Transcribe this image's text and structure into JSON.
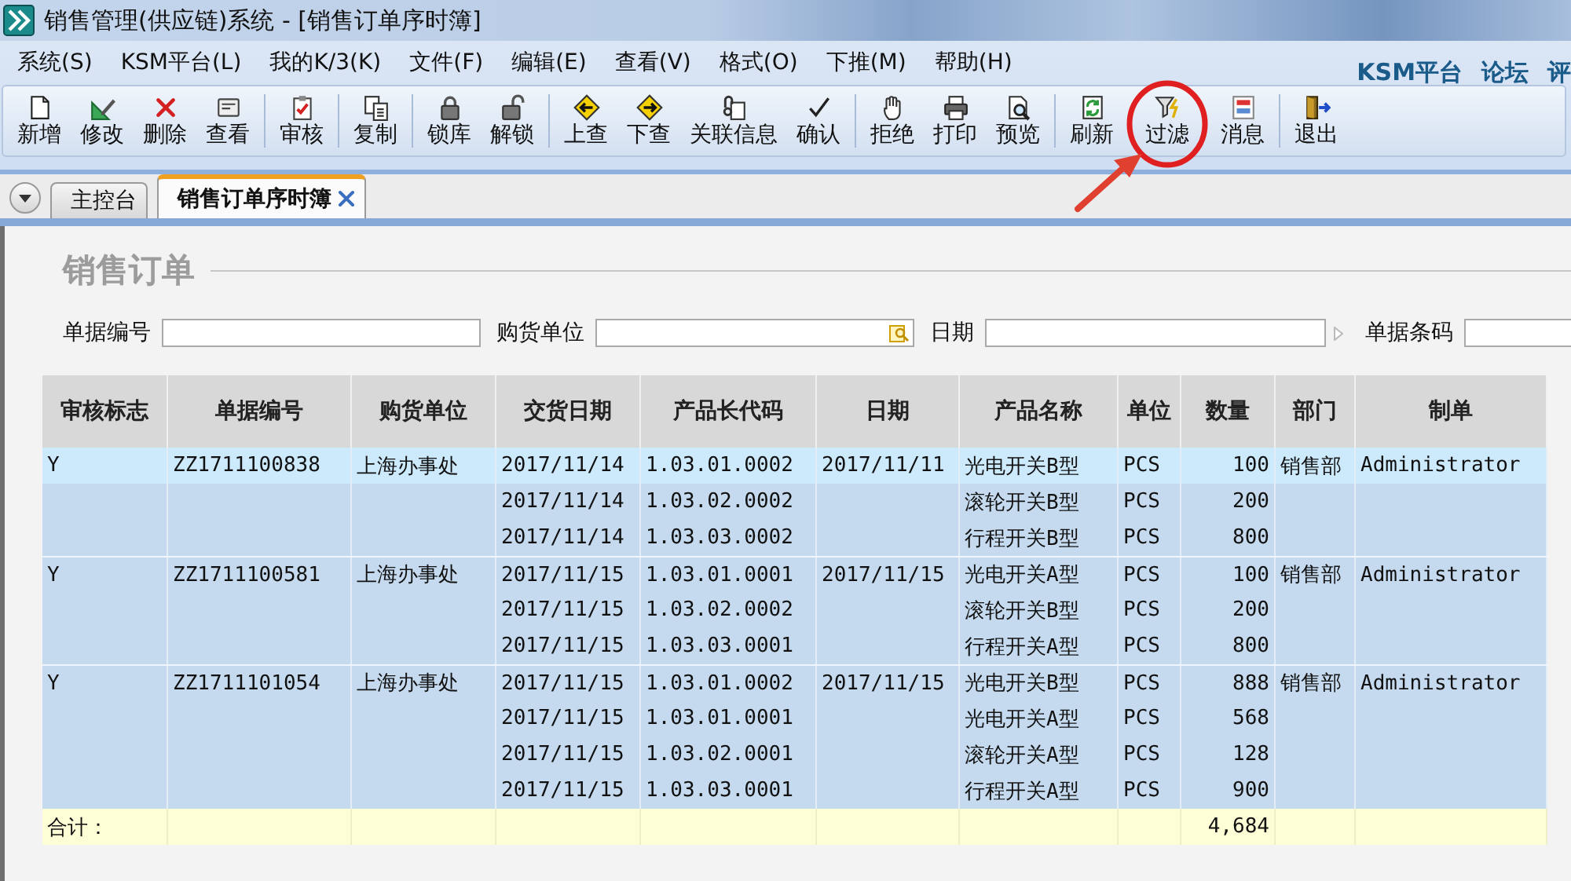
{
  "window": {
    "title": "销售管理(供应链)系统 - [销售订单序时簿]"
  },
  "menu": {
    "items": [
      "系统(S)",
      "KSM平台(L)",
      "我的K/3(K)",
      "文件(F)",
      "编辑(E)",
      "查看(V)",
      "格式(O)",
      "下推(M)",
      "帮助(H)"
    ],
    "links": [
      "KSM平台",
      "论坛",
      "评"
    ]
  },
  "toolbar": {
    "groups": [
      {
        "buttons": [
          {
            "label": "新增",
            "highlighted": false
          },
          {
            "label": "修改",
            "highlighted": false
          },
          {
            "label": "删除",
            "highlighted": false
          },
          {
            "label": "查看",
            "highlighted": false
          }
        ]
      },
      {
        "buttons": [
          {
            "label": "审核",
            "highlighted": false
          }
        ]
      },
      {
        "buttons": [
          {
            "label": "复制",
            "highlighted": false
          }
        ]
      },
      {
        "buttons": [
          {
            "label": "锁库",
            "highlighted": false
          },
          {
            "label": "解锁",
            "highlighted": false
          }
        ]
      },
      {
        "buttons": [
          {
            "label": "上查",
            "highlighted": false
          },
          {
            "label": "下查",
            "highlighted": false
          },
          {
            "label": "关联信息",
            "highlighted": false
          },
          {
            "label": "确认",
            "highlighted": false
          }
        ]
      },
      {
        "buttons": [
          {
            "label": "拒绝",
            "highlighted": false
          },
          {
            "label": "打印",
            "highlighted": false
          },
          {
            "label": "预览",
            "highlighted": false
          }
        ]
      },
      {
        "buttons": [
          {
            "label": "刷新",
            "highlighted": false
          },
          {
            "label": "过滤",
            "highlighted": true
          },
          {
            "label": "消息",
            "highlighted": false
          }
        ]
      },
      {
        "buttons": [
          {
            "label": "退出",
            "highlighted": false
          }
        ]
      }
    ]
  },
  "tabs": [
    {
      "label": "主控台",
      "selected": false
    },
    {
      "label": "销售订单序时簿",
      "selected": true
    }
  ],
  "form": {
    "title": "销售订单",
    "fields": [
      {
        "label": "单据编号",
        "kind": "text"
      },
      {
        "label": "购货单位",
        "kind": "lookup"
      },
      {
        "label": "日期",
        "kind": "range"
      },
      {
        "label": "单据条码",
        "kind": "text"
      }
    ]
  },
  "table": {
    "columns": [
      "审核标志",
      "单据编号",
      "购货单位",
      "交货日期",
      "产品长代码",
      "日期",
      "产品名称",
      "单位",
      "数量",
      "部门",
      "制单"
    ],
    "orders": [
      {
        "audit": "Y",
        "number": "ZZ1711100838",
        "customer": "上海办事处",
        "date": "2017/11/11",
        "department": "销售部",
        "maker": "Administrator",
        "lines": [
          {
            "delivery_date": "2017/11/14",
            "code": "1.03.01.0002",
            "product": "光电开关B型",
            "unit": "PCS",
            "quantity": "100",
            "selected": true
          },
          {
            "delivery_date": "2017/11/14",
            "code": "1.03.02.0002",
            "product": "滚轮开关B型",
            "unit": "PCS",
            "quantity": "200",
            "selected": false
          },
          {
            "delivery_date": "2017/11/14",
            "code": "1.03.03.0002",
            "product": "行程开关B型",
            "unit": "PCS",
            "quantity": "800",
            "selected": false
          }
        ]
      },
      {
        "audit": "Y",
        "number": "ZZ1711100581",
        "customer": "上海办事处",
        "date": "2017/11/15",
        "department": "销售部",
        "maker": "Administrator",
        "lines": [
          {
            "delivery_date": "2017/11/15",
            "code": "1.03.01.0001",
            "product": "光电开关A型",
            "unit": "PCS",
            "quantity": "100",
            "selected": false
          },
          {
            "delivery_date": "2017/11/15",
            "code": "1.03.02.0002",
            "product": "滚轮开关B型",
            "unit": "PCS",
            "quantity": "200",
            "selected": false
          },
          {
            "delivery_date": "2017/11/15",
            "code": "1.03.03.0001",
            "product": "行程开关A型",
            "unit": "PCS",
            "quantity": "800",
            "selected": false
          }
        ]
      },
      {
        "audit": "Y",
        "number": "ZZ1711101054",
        "customer": "上海办事处",
        "date": "2017/11/15",
        "department": "销售部",
        "maker": "Administrator",
        "lines": [
          {
            "delivery_date": "2017/11/15",
            "code": "1.03.01.0002",
            "product": "光电开关B型",
            "unit": "PCS",
            "quantity": "888",
            "selected": false
          },
          {
            "delivery_date": "2017/11/15",
            "code": "1.03.01.0001",
            "product": "光电开关A型",
            "unit": "PCS",
            "quantity": "568",
            "selected": false
          },
          {
            "delivery_date": "2017/11/15",
            "code": "1.03.02.0001",
            "product": "滚轮开关A型",
            "unit": "PCS",
            "quantity": "128",
            "selected": false
          },
          {
            "delivery_date": "2017/11/15",
            "code": "1.03.03.0001",
            "product": "行程开关A型",
            "unit": "PCS",
            "quantity": "900",
            "selected": false
          }
        ]
      }
    ],
    "total": {
      "label": "合计：",
      "quantity": "4,684"
    }
  }
}
